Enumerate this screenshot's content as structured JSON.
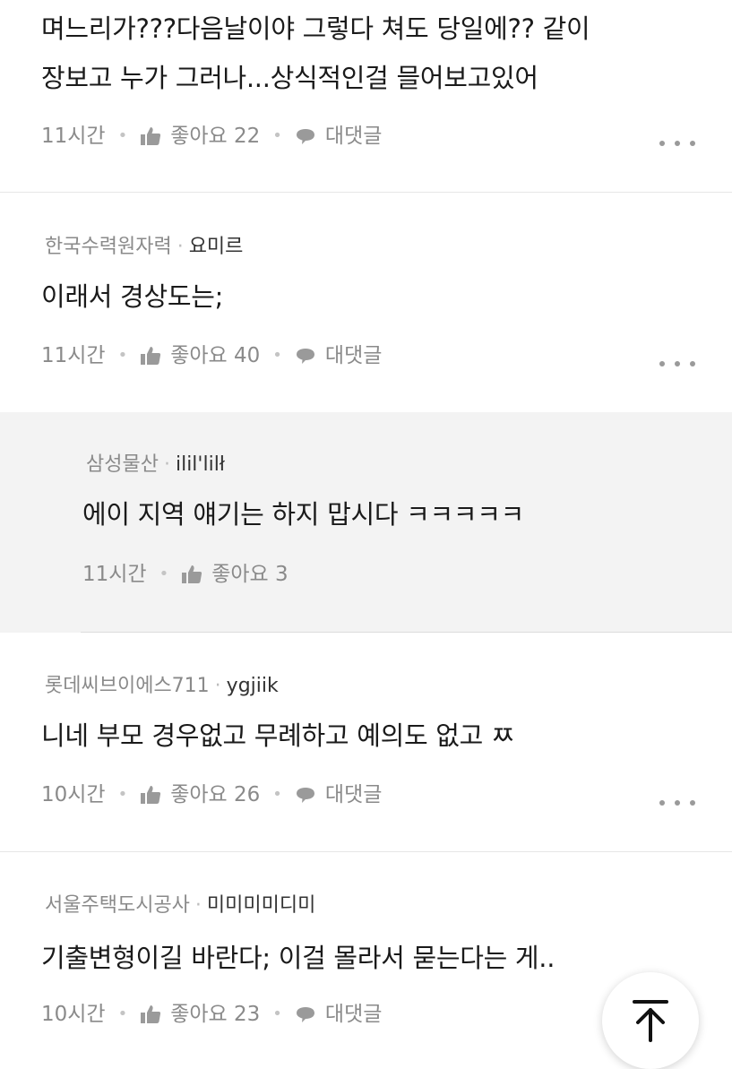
{
  "comments": [
    {
      "company": "",
      "nickname": "",
      "lines": [
        "며느리가???다음날이야 그렇다 쳐도 당일에?? 같이",
        "장보고 누가 그러나...상식적인걸 믈어보고있어"
      ],
      "time": "11시간",
      "like_label": "좋아요",
      "like_count": "22",
      "reply_label": "대댓글"
    },
    {
      "company": "한국수력원자력",
      "nickname": "요미르",
      "lines": [
        "이래서 경상도는;"
      ],
      "time": "11시간",
      "like_label": "좋아요",
      "like_count": "40",
      "reply_label": "대댓글"
    },
    {
      "company": "삼성물산",
      "nickname": "ilil'lilł",
      "lines": [
        "에이 지역 얘기는 하지 맙시다 ㅋㅋㅋㅋㅋ"
      ],
      "time": "11시간",
      "like_label": "좋아요",
      "like_count": "3",
      "reply_label": ""
    },
    {
      "company": "롯데씨브이에스711",
      "nickname": "ygjiik",
      "lines": [
        "니네 부모 경우없고 무례하고 예의도 없고 ㅉ"
      ],
      "time": "10시간",
      "like_label": "좋아요",
      "like_count": "26",
      "reply_label": "대댓글"
    },
    {
      "company": "서울주택도시공사",
      "nickname": "미미미미디미",
      "lines": [
        "기출변형이길 바란다; 이걸 몰라서 묻는다는 게.."
      ],
      "time": "10시간",
      "like_label": "좋아요",
      "like_count": "23",
      "reply_label": "대댓글"
    }
  ],
  "icons": {
    "like": "thumbs-up-icon",
    "reply": "speech-bubble-icon",
    "more": "more-dots-icon",
    "scroll_top": "arrow-up-to-top-icon"
  },
  "colors": {
    "text": "#1a1a1a",
    "meta": "#8a8a8a",
    "reply_bg": "#f3f3f3",
    "divider": "#e6e6e6"
  }
}
